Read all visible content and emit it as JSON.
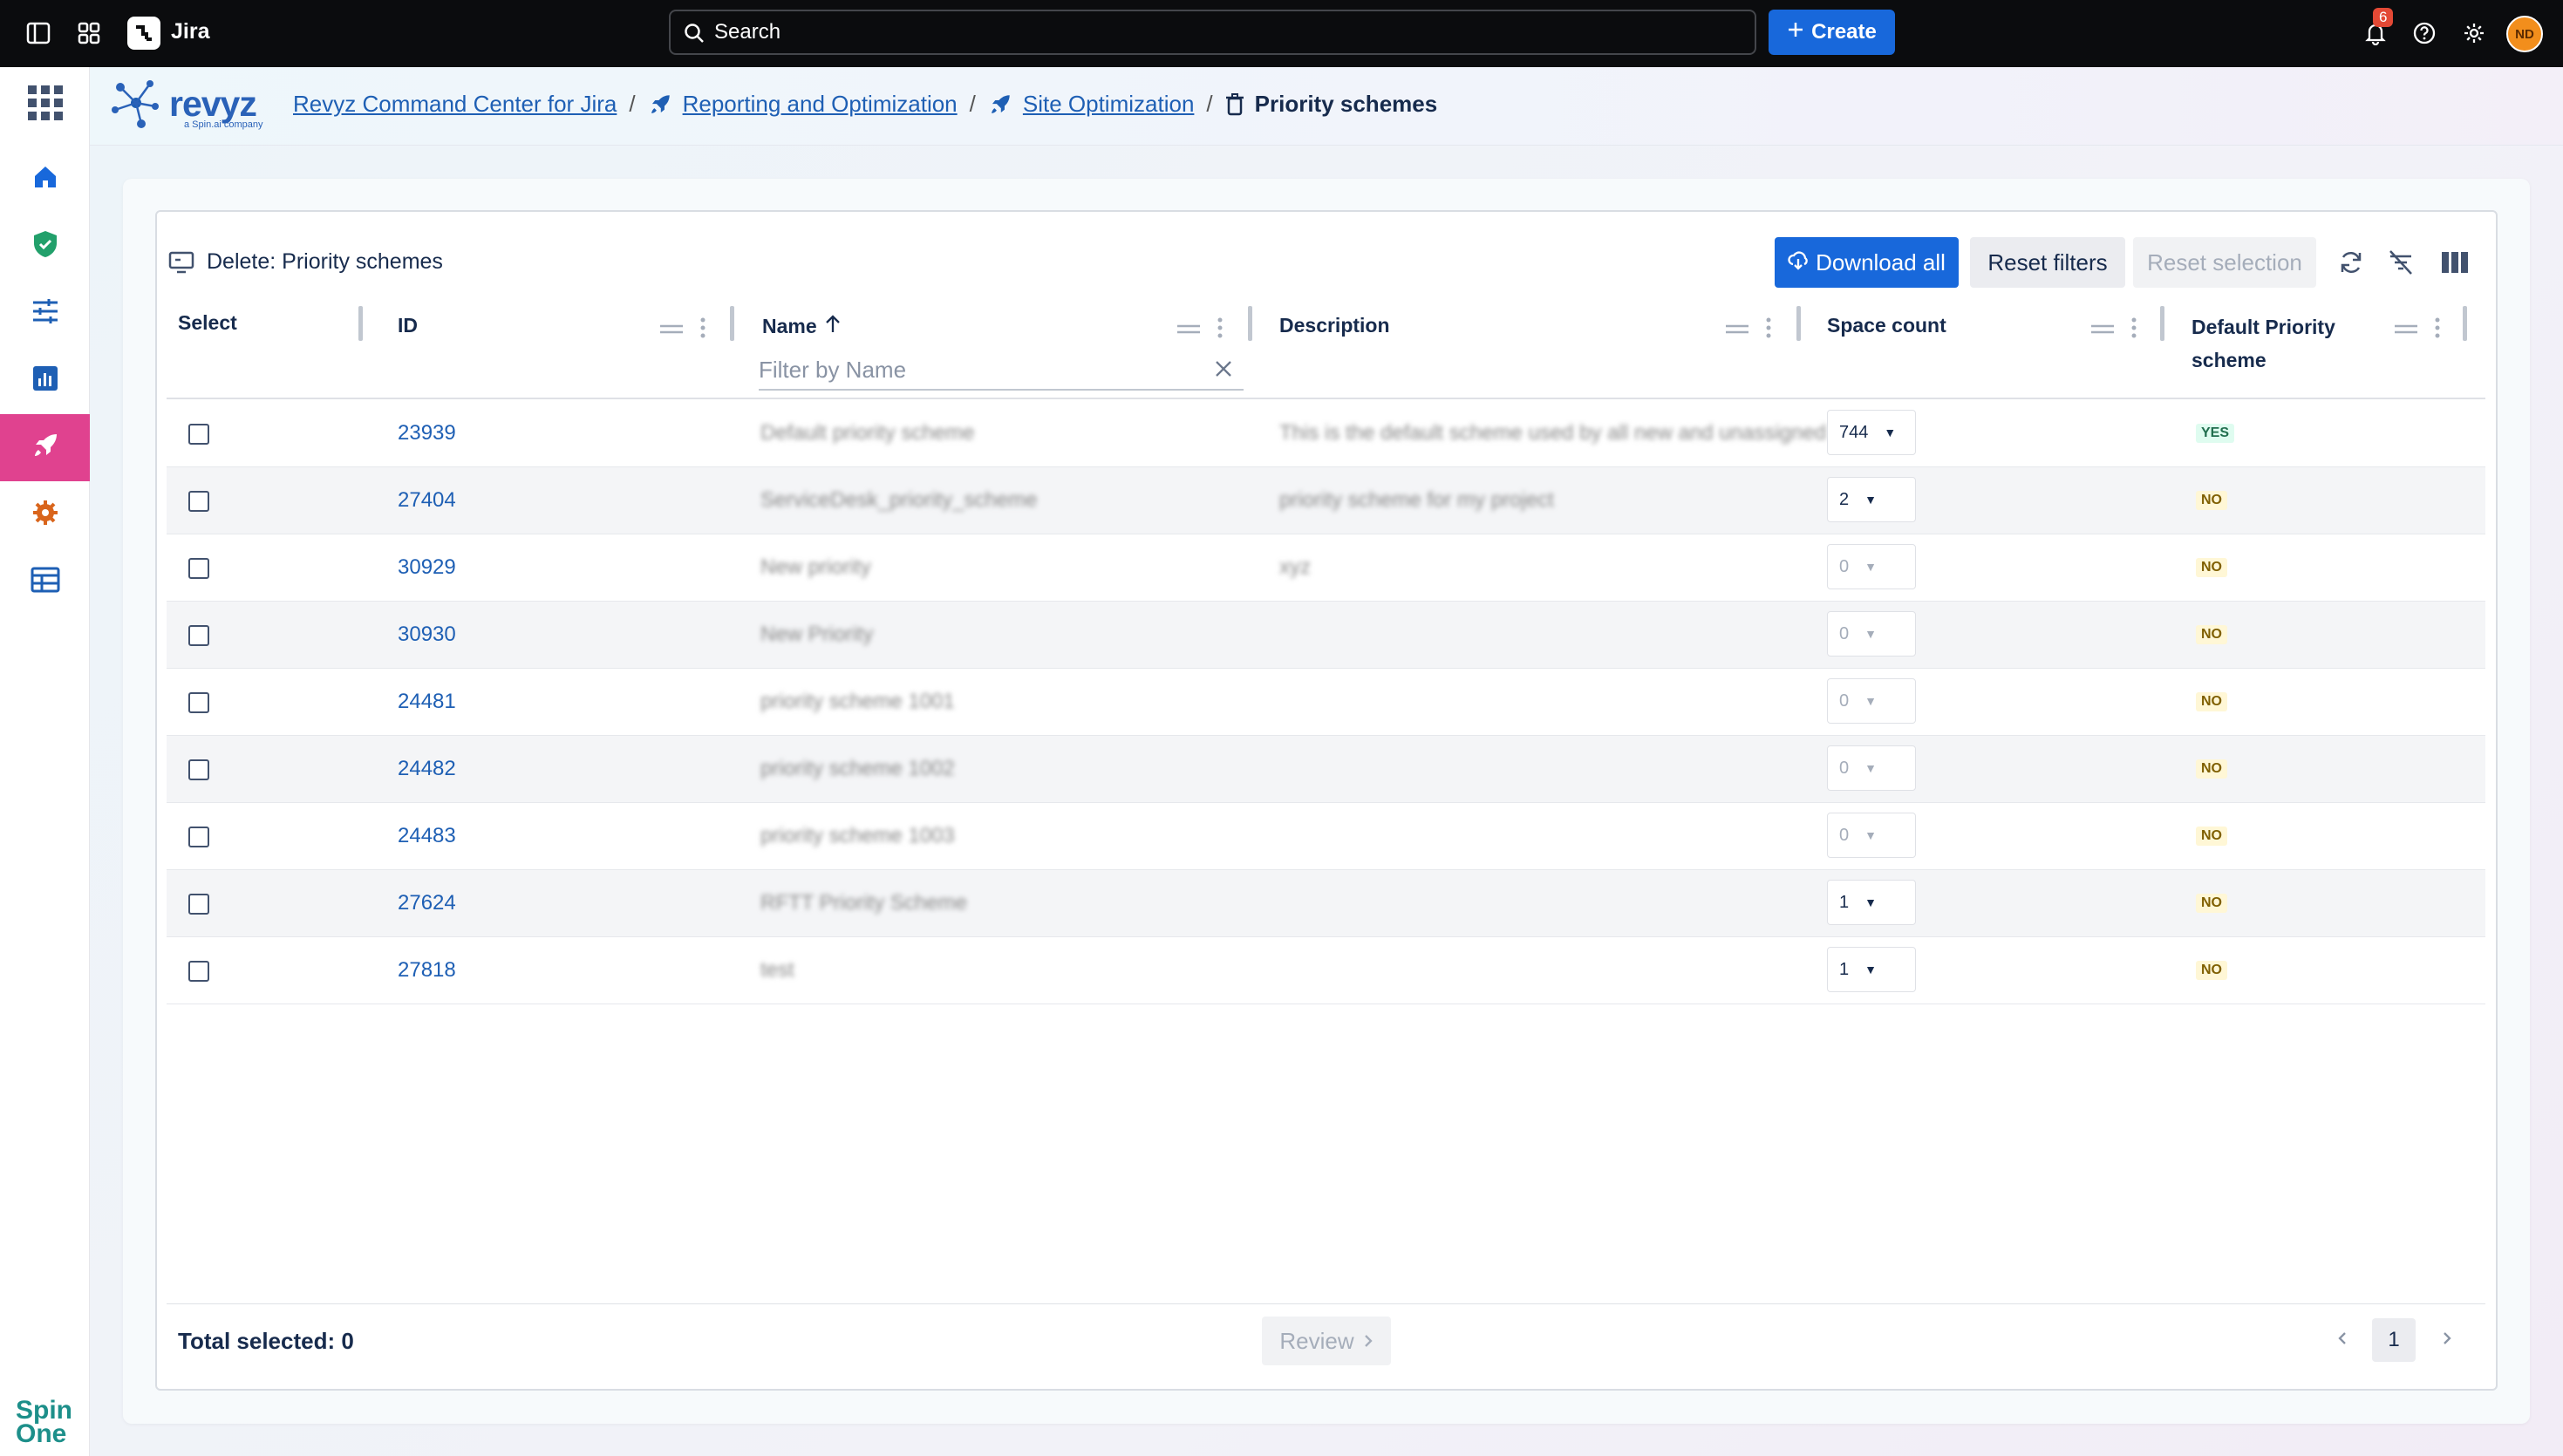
{
  "topbar": {
    "app_name": "Jira",
    "search_placeholder": "Search",
    "create_label": "Create",
    "notification_count": "6",
    "avatar_initials": "ND"
  },
  "sidebar": {
    "items": [
      "home",
      "backup-shield",
      "settings-sliders",
      "reports",
      "site-optimization",
      "settings-gear",
      "table-view"
    ],
    "active_item": "site-optimization",
    "footer_logo": "Spin One"
  },
  "header": {
    "logo_word": "revyz",
    "logo_sub": "a Spin.ai company",
    "breadcrumb": {
      "item1": "Revyz Command Center for Jira",
      "item2": "Reporting and Optimization",
      "item3": "Site Optimization",
      "current": "Priority schemes"
    }
  },
  "card": {
    "title": "Delete: Priority schemes",
    "download_all": "Download all",
    "reset_filters": "Reset filters",
    "reset_selection": "Reset selection"
  },
  "table": {
    "columns": {
      "select": "Select",
      "id": "ID",
      "name": "Name",
      "description": "Description",
      "space_count": "Space count",
      "default_line1": "Default Priority",
      "default_line2": "scheme"
    },
    "name_sort": "ascending",
    "filter_placeholder": "Filter by Name",
    "rows": [
      {
        "id": "23939",
        "name": "Default priority scheme",
        "description": "This is the default scheme used by all new and unassigned p",
        "space_count": "744",
        "default": "YES"
      },
      {
        "id": "27404",
        "name": "ServiceDesk_priority_scheme",
        "description": "priority scheme for my project",
        "space_count": "2",
        "default": "NO"
      },
      {
        "id": "30929",
        "name": "New priority",
        "description": "xyz",
        "space_count": "0",
        "default": "NO"
      },
      {
        "id": "30930",
        "name": "New Priority",
        "description": "",
        "space_count": "0",
        "default": "NO"
      },
      {
        "id": "24481",
        "name": "priority scheme 1001",
        "description": "",
        "space_count": "0",
        "default": "NO"
      },
      {
        "id": "24482",
        "name": "priority scheme 1002",
        "description": "",
        "space_count": "0",
        "default": "NO"
      },
      {
        "id": "24483",
        "name": "priority scheme 1003",
        "description": "",
        "space_count": "0",
        "default": "NO"
      },
      {
        "id": "27624",
        "name": "RFTT Priority Scheme",
        "description": "",
        "space_count": "1",
        "default": "NO"
      },
      {
        "id": "27818",
        "name": "test",
        "description": "",
        "space_count": "1",
        "default": "NO"
      }
    ]
  },
  "footer": {
    "total_selected": "Total selected: 0",
    "review_label": "Review",
    "current_page": "1"
  },
  "colors": {
    "topbar": "#0b0c0e",
    "primary": "#1868db",
    "active_sidebar": "#e0428f",
    "link": "#1e5fb4"
  }
}
